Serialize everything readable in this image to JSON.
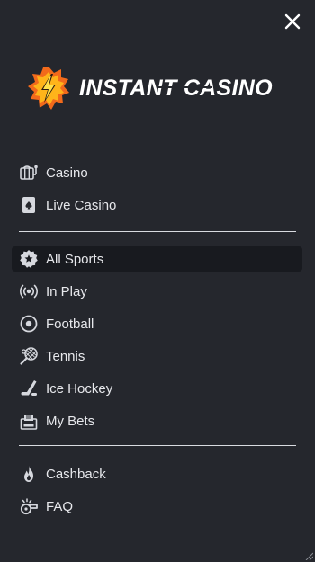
{
  "brand": {
    "name": "INSTANT CASINO"
  },
  "menu": {
    "group1": [
      {
        "label": "Casino",
        "icon": "slot-machine-icon"
      },
      {
        "label": "Live Casino",
        "icon": "playing-card-icon"
      }
    ],
    "group2": [
      {
        "label": "All Sports",
        "icon": "star-badge-icon",
        "active": true
      },
      {
        "label": "In Play",
        "icon": "live-signal-icon"
      },
      {
        "label": "Football",
        "icon": "football-icon"
      },
      {
        "label": "Tennis",
        "icon": "tennis-racket-icon"
      },
      {
        "label": "Ice Hockey",
        "icon": "hockey-stick-icon"
      },
      {
        "label": "My Bets",
        "icon": "bet-slip-icon"
      }
    ],
    "group3": [
      {
        "label": "Cashback",
        "icon": "flame-icon"
      },
      {
        "label": "FAQ",
        "icon": "whistle-icon"
      }
    ]
  },
  "colors": {
    "background": "#25272d",
    "active_item": "#181a1f",
    "text": "#e7e8ec",
    "logo_orange": "#f26a1b",
    "logo_yellow": "#ffc21a"
  }
}
